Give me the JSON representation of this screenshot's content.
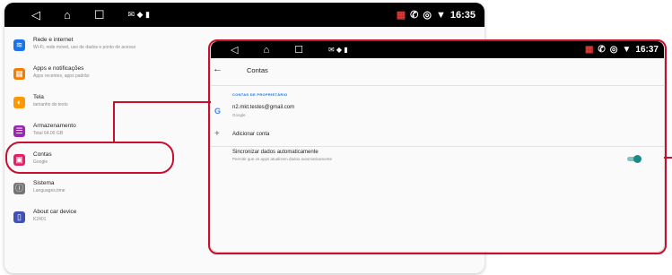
{
  "colors": {
    "highlight": "#c8102e",
    "accent": "#1a73e8",
    "toggle": "#1a8a84"
  },
  "back": {
    "status_time": "16:35",
    "items": [
      {
        "title": "Rede e internet",
        "subtitle": "Wi-Fi, rede móvel, uso de dados e ponto de acesso",
        "color": "#1a73e8",
        "icon": "wifi-icon"
      },
      {
        "title": "Apps e notificações",
        "subtitle": "Apps recentes, apps padrão",
        "color": "#f57c00",
        "icon": "apps-icon"
      },
      {
        "title": "Tela",
        "subtitle": "tamanho do texto",
        "color": "#ff9800",
        "icon": "display-icon"
      },
      {
        "title": "Armazenamento",
        "subtitle": "Total 64.00 GB",
        "color": "#9c27b0",
        "icon": "storage-icon"
      },
      {
        "title": "Contas",
        "subtitle": "Google",
        "color": "#e91e63",
        "icon": "accounts-icon"
      },
      {
        "title": "Sistema",
        "subtitle": "Languages,time",
        "color": "#757575",
        "icon": "info-icon"
      },
      {
        "title": "About car device",
        "subtitle": "K2401",
        "color": "#3f51b5",
        "icon": "phone-icon"
      }
    ]
  },
  "front": {
    "status_time": "16:37",
    "title": "Contas",
    "section": "CONTAS DE PROPRIETÁRIO",
    "account_email": "n2.mkt.testes@gmail.com",
    "account_provider": "Google",
    "add_label": "Adicionar conta",
    "sync_title": "Sincronizar dados automaticamente",
    "sync_subtitle": "Permitir que os apps atualizem dados automaticamente",
    "sync_on": true
  }
}
